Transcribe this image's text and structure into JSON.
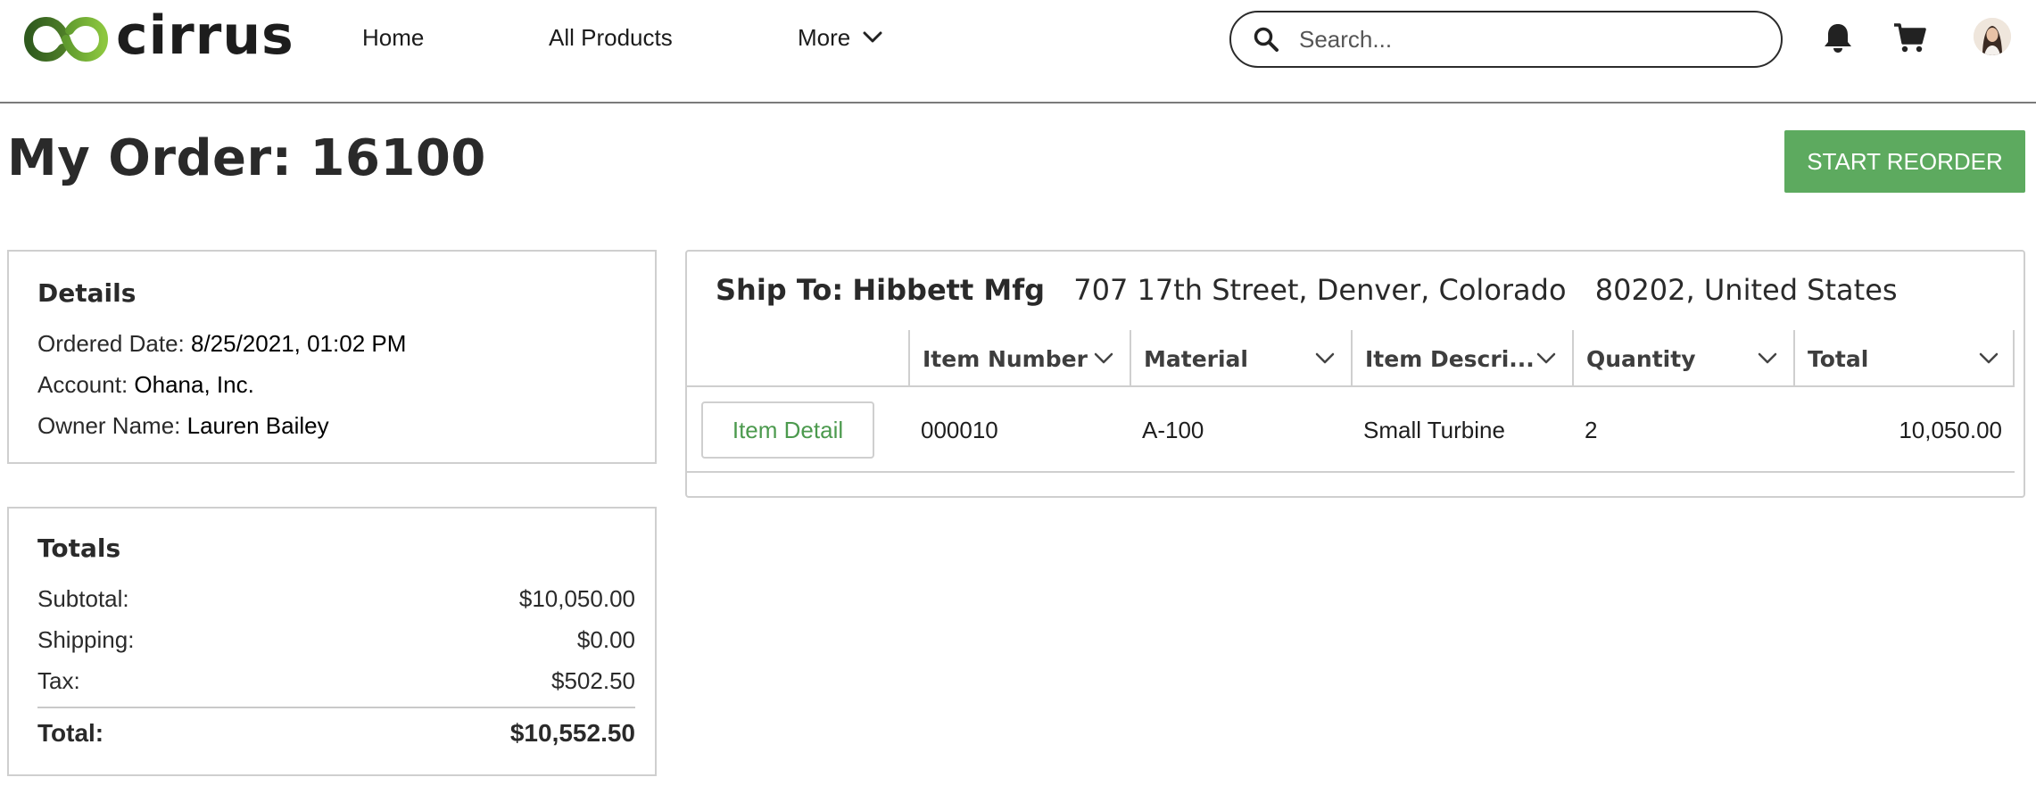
{
  "header": {
    "brand": "cirrus",
    "nav": {
      "home": "Home",
      "all_products": "All Products",
      "more": "More"
    },
    "search": {
      "placeholder": "Search...",
      "value": ""
    },
    "icons": [
      "bell-icon",
      "cart-icon",
      "user-avatar"
    ]
  },
  "page": {
    "title": "My Order: 16100",
    "reorder_button": "START REORDER"
  },
  "details": {
    "heading": "Details",
    "ordered_date_label": "Ordered Date:",
    "ordered_date": "8/25/2021, 01:02 PM",
    "account_label": "Account:",
    "account": "Ohana, Inc.",
    "owner_label": "Owner Name:",
    "owner": "Lauren Bailey"
  },
  "totals": {
    "heading": "Totals",
    "subtotal_label": "Subtotal:",
    "subtotal": "$10,050.00",
    "shipping_label": "Shipping:",
    "shipping": "$0.00",
    "tax_label": "Tax:",
    "tax": "$502.50",
    "total_label": "Total:",
    "total": "$10,552.50"
  },
  "ship_to": {
    "label": "Ship To:",
    "name": "Hibbett Mfg",
    "address": "707 17th Street, Denver, Colorado",
    "postal_country": "80202, United States"
  },
  "table": {
    "columns": [
      "Item Number",
      "Material",
      "Item Descri...",
      "Quantity",
      "Total"
    ],
    "rows": [
      {
        "action": "Item Detail",
        "item_number": "000010",
        "material": "A-100",
        "description": "Small Turbine",
        "quantity": "2",
        "total": "10,050.00"
      }
    ]
  },
  "colors": {
    "brand_green": "#5daa5f",
    "logo_dark_green": "#2f5a1e",
    "logo_light_green": "#8cc63f",
    "link_green": "#4c9a4e",
    "border_gray": "#cfcfcf"
  }
}
